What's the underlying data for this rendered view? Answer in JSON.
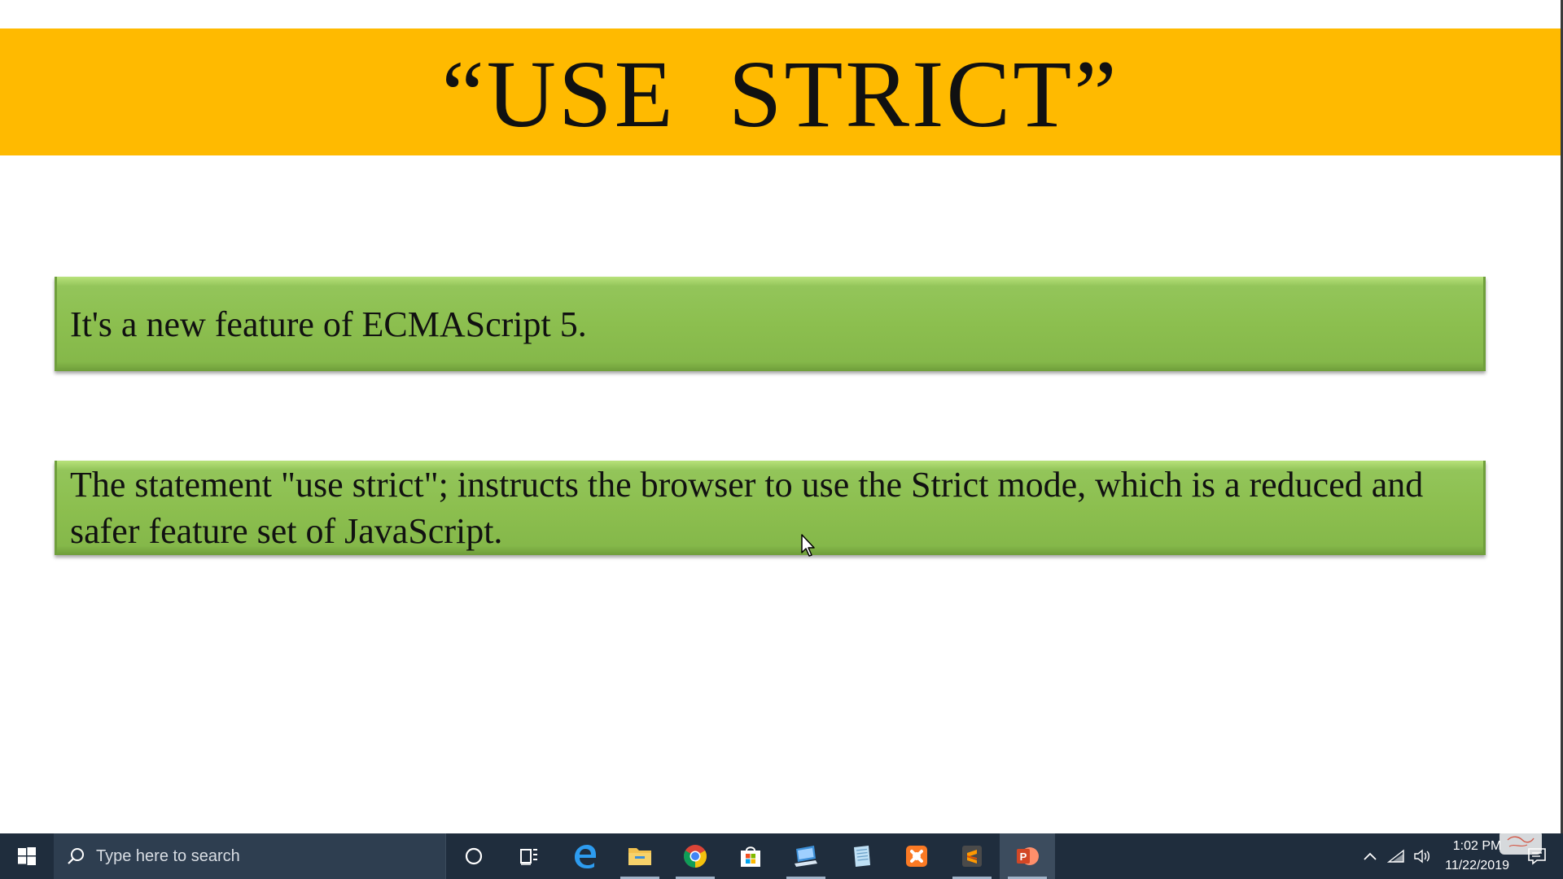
{
  "slide": {
    "title": "“USE  STRICT”",
    "bullets": [
      "It's a new feature of ECMAScript 5.",
      "The statement \"use strict\"; instructs the browser to use the Strict mode, which is a reduced and safer feature set of JavaScript."
    ],
    "colors": {
      "title_band": "#ffba00",
      "bullet_fill": "#8cbf4f"
    }
  },
  "taskbar": {
    "search_placeholder": "Type here to search",
    "pinned_icons": [
      "cortana-icon",
      "task-view-icon",
      "edge-icon",
      "file-explorer-icon",
      "chrome-icon",
      "store-icon",
      "remote-desktop-icon",
      "notepad-icon",
      "xampp-icon",
      "sublime-text-icon",
      "powerpoint-icon"
    ],
    "clock": {
      "time": "1:02 PM",
      "date": "11/22/2019"
    }
  }
}
